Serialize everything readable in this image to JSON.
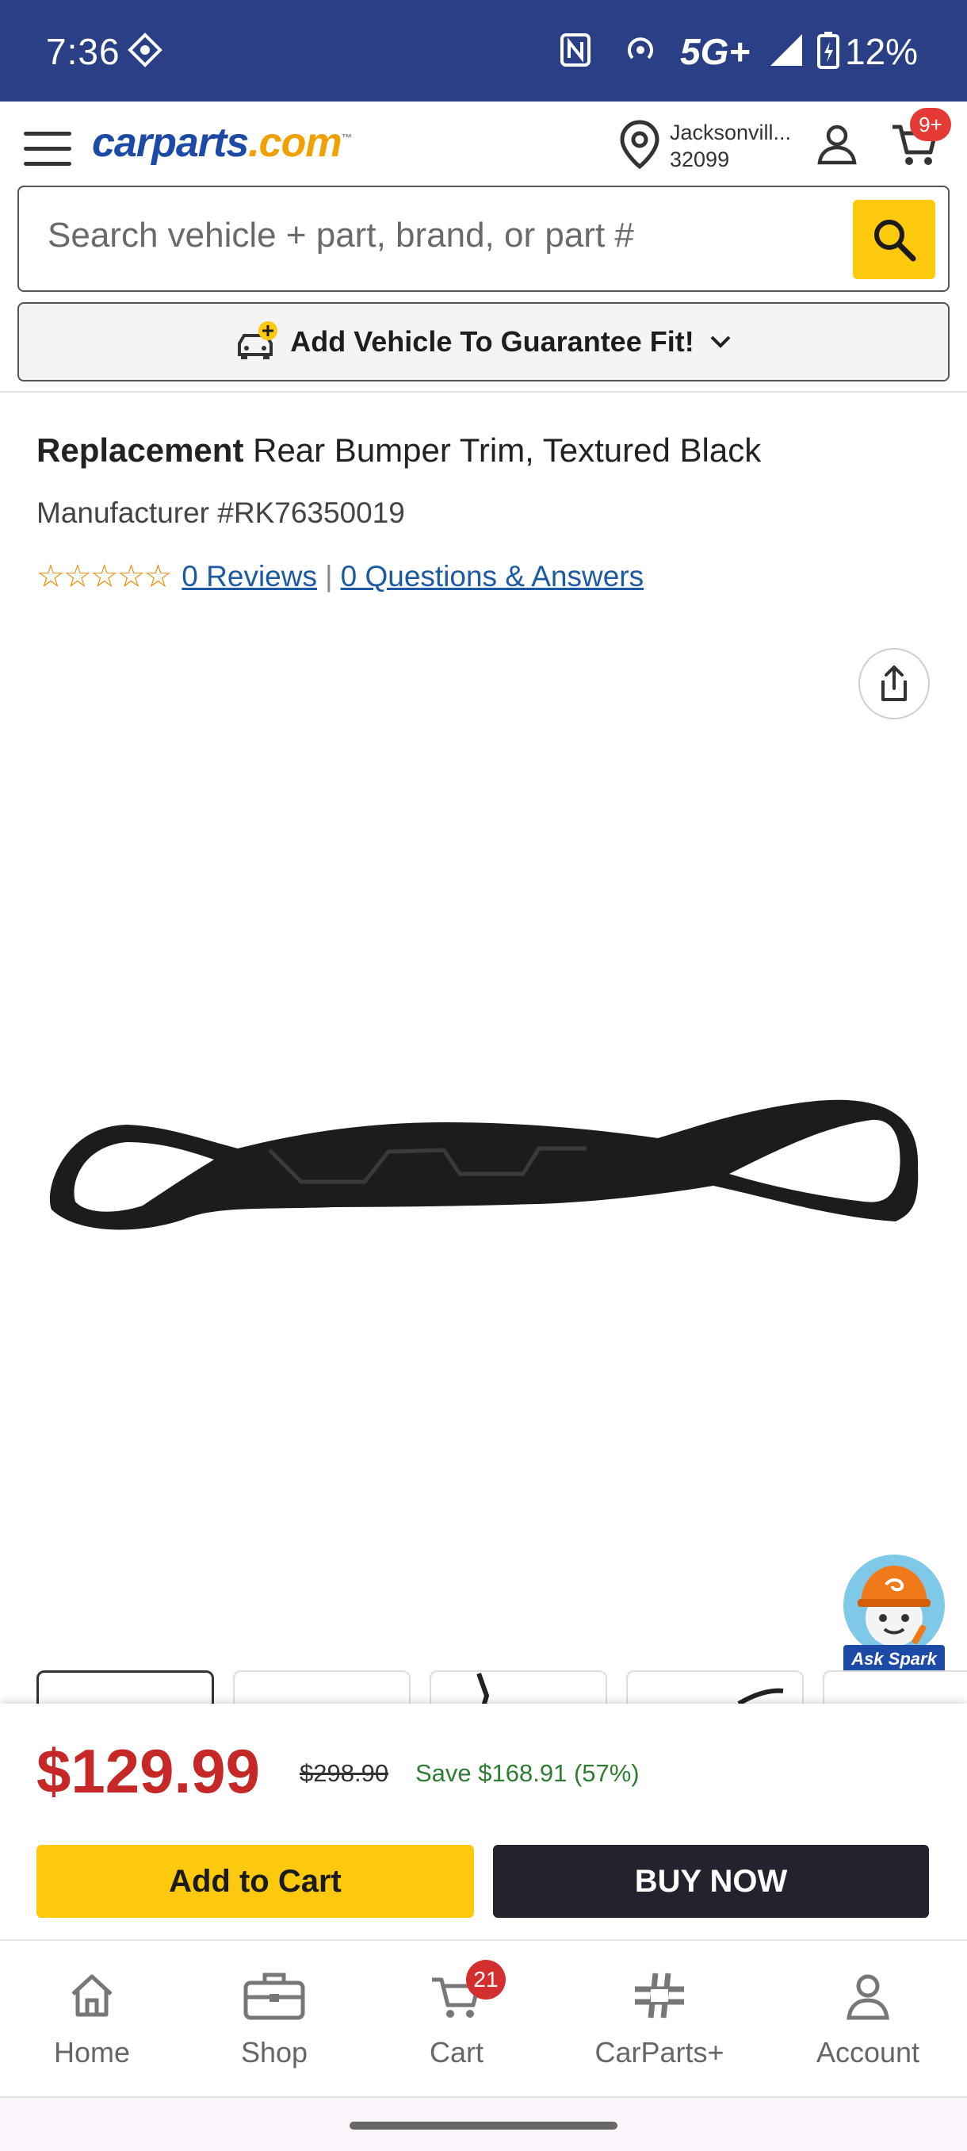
{
  "status_bar": {
    "time": "7:36",
    "network": "5G+",
    "battery": "12%"
  },
  "header": {
    "logo_main": "carparts",
    "logo_tld": ".com",
    "logo_tm": "™",
    "location_city": "Jacksonvill...",
    "location_zip": "32099",
    "cart_badge": "9+"
  },
  "search": {
    "placeholder": "Search vehicle + part, brand, or part #"
  },
  "vehicle": {
    "label": "Add Vehicle To Guarantee Fit!"
  },
  "product": {
    "brand": "Replacement",
    "name": " Rear Bumper Trim, Textured Black",
    "manufacturer": "Manufacturer #RK76350019",
    "stars": "☆☆☆☆☆",
    "reviews": "0 Reviews",
    "questions": "0 Questions & Answers"
  },
  "assistant": {
    "label": "Ask Spark"
  },
  "pricing": {
    "price": "$129.99",
    "old_price": "$298.90",
    "savings": "Save $168.91 (57%)",
    "add_to_cart": "Add to Cart",
    "buy_now": "BUY NOW"
  },
  "bottom_nav": {
    "items": [
      {
        "label": "Home",
        "icon": "home-icon"
      },
      {
        "label": "Shop",
        "icon": "toolbox-icon"
      },
      {
        "label": "Cart",
        "icon": "cart-icon",
        "badge": "21"
      },
      {
        "label": "CarParts+",
        "icon": "carparts-plus-icon"
      },
      {
        "label": "Account",
        "icon": "account-icon"
      }
    ]
  },
  "colors": {
    "status_bar": "#2b3f86",
    "brand_blue": "#1c4aa6",
    "accent_yellow": "#fcc90c",
    "price_red": "#c62828",
    "savings_green": "#2e7d32",
    "buy_now_dark": "#23232d"
  }
}
